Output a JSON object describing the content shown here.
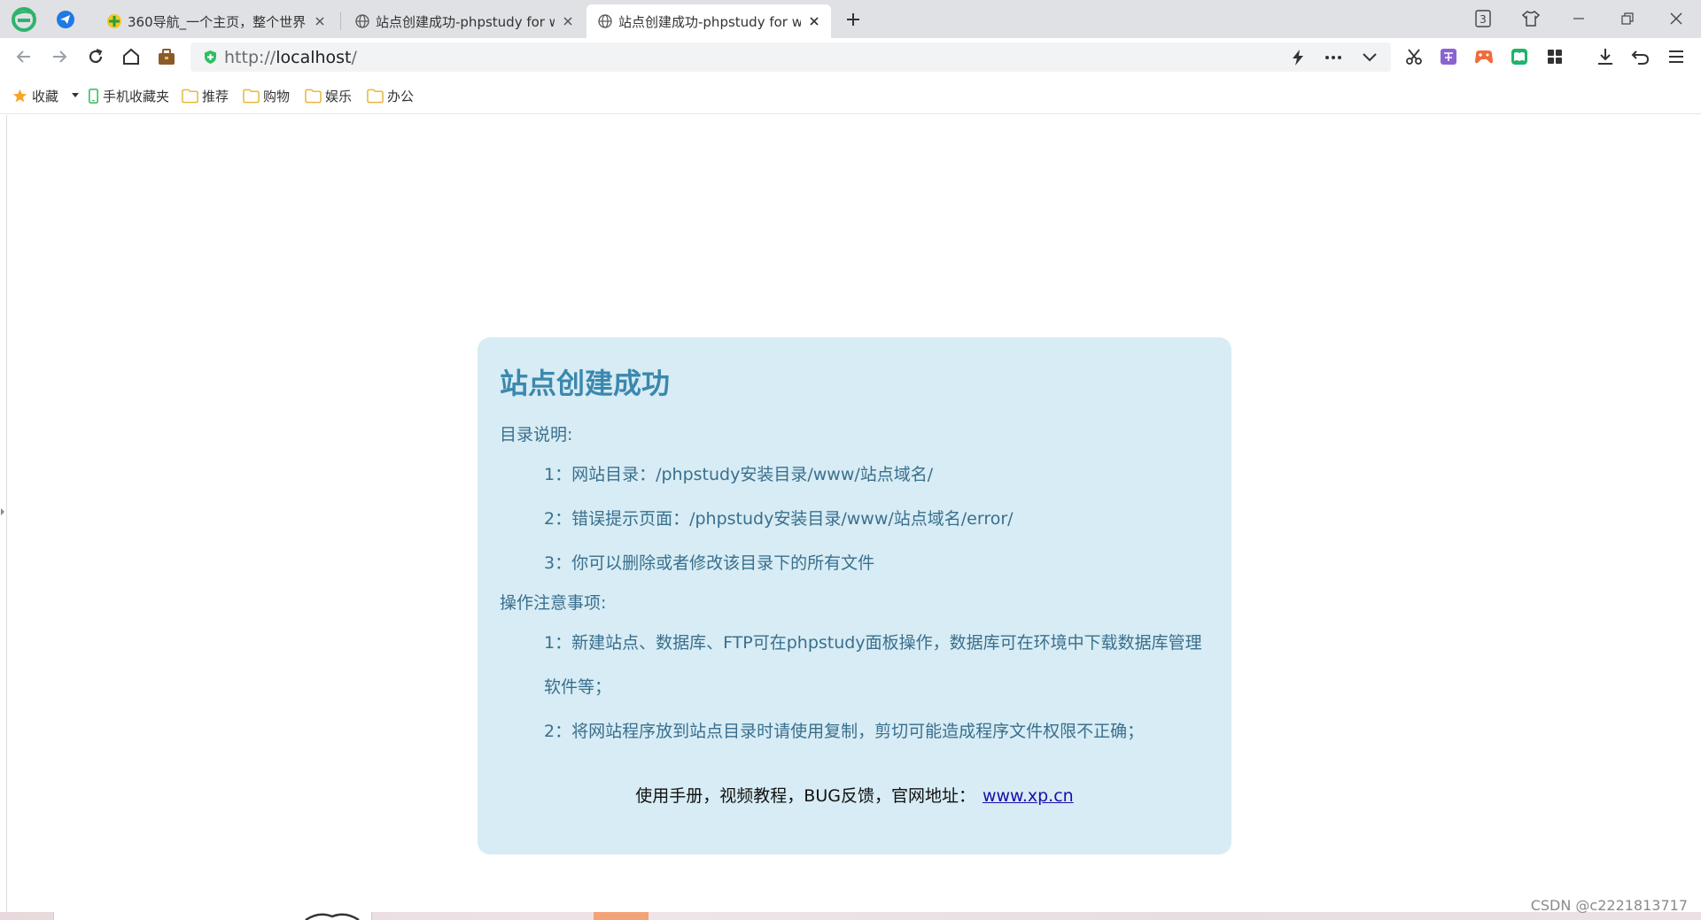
{
  "tabs": [
    {
      "label": "360导航_一个主页，整个世界",
      "favicon": "360-nav-icon",
      "active": false
    },
    {
      "label": "站点创建成功-phpstudy for windows",
      "favicon": "globe-icon",
      "active": false
    },
    {
      "label": "站点创建成功-phpstudy for windows",
      "favicon": "globe-icon",
      "active": true
    }
  ],
  "window": {
    "tab_count_badge": "3"
  },
  "address": {
    "protocol": "http://",
    "host": "localhost",
    "path": "/"
  },
  "bookmarks": [
    {
      "label": "收藏",
      "icon": "star-icon"
    },
    {
      "label": "手机收藏夹",
      "icon": "phone-icon"
    },
    {
      "label": "推荐",
      "icon": "folder-icon"
    },
    {
      "label": "购物",
      "icon": "folder-icon"
    },
    {
      "label": "娱乐",
      "icon": "folder-icon"
    },
    {
      "label": "办公",
      "icon": "folder-icon"
    }
  ],
  "page": {
    "title": "站点创建成功",
    "sections": [
      {
        "heading": "目录说明:",
        "items": [
          "1：网站目录：/phpstudy安装目录/www/站点域名/",
          "2：错误提示页面：/phpstudy安装目录/www/站点域名/error/",
          "3：你可以删除或者修改该目录下的所有文件"
        ]
      },
      {
        "heading": "操作注意事项:",
        "items": [
          "1：新建站点、数据库、FTP可在phpstudy面板操作，数据库可在环境中下载数据库管理软件等；",
          "2：将网站程序放到站点目录时请使用复制，剪切可能造成程序文件权限不正确；"
        ]
      }
    ],
    "footer_text": "使用手册，视频教程，BUG反馈，官网地址：",
    "footer_link": "www.xp.cn"
  },
  "watermark": "CSDN @c2221813717",
  "colors": {
    "card_bg": "#d7ecf4",
    "title": "#3b88ae",
    "body_text": "#3a6f8e",
    "link": "#1a0dab",
    "tabstrip_bg": "#dfe1e5",
    "secure_green": "#2dbe60"
  }
}
